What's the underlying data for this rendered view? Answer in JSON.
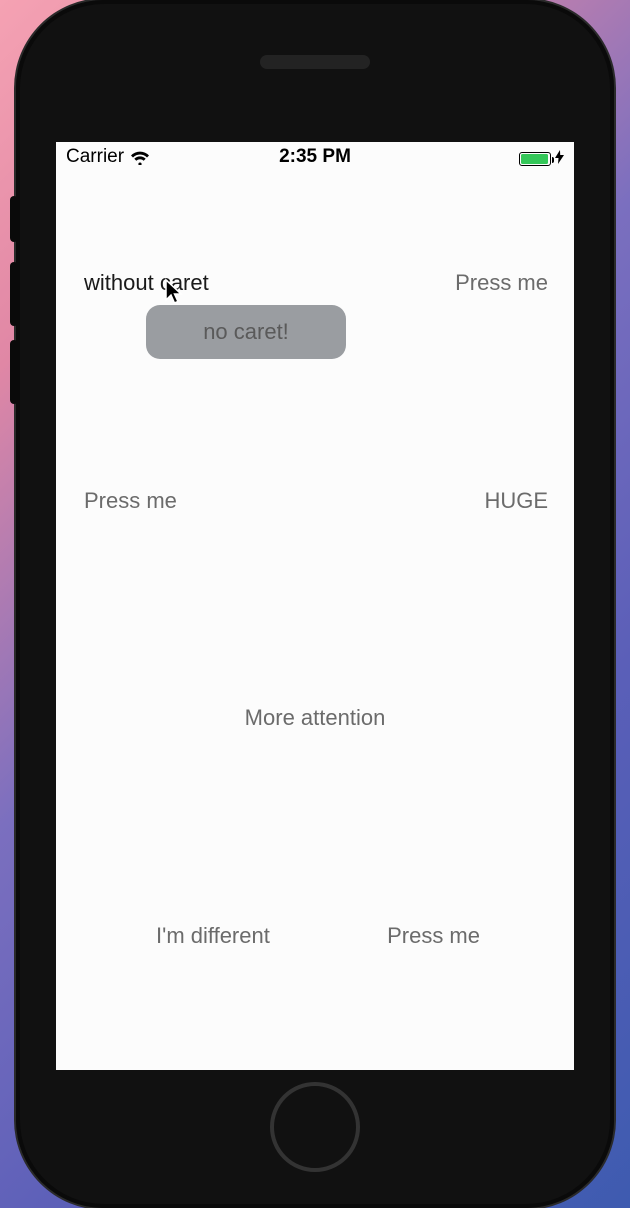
{
  "statusbar": {
    "carrier": "Carrier",
    "time": "2:35 PM"
  },
  "tooltip": {
    "text": "no caret!"
  },
  "labels": {
    "without_caret": "without caret",
    "press_me_top_right": "Press me",
    "press_me_mid_left": "Press me",
    "huge": "HUGE",
    "more_attention": "More attention",
    "im_different": "I'm different",
    "press_me_bottom_right": "Press me"
  }
}
